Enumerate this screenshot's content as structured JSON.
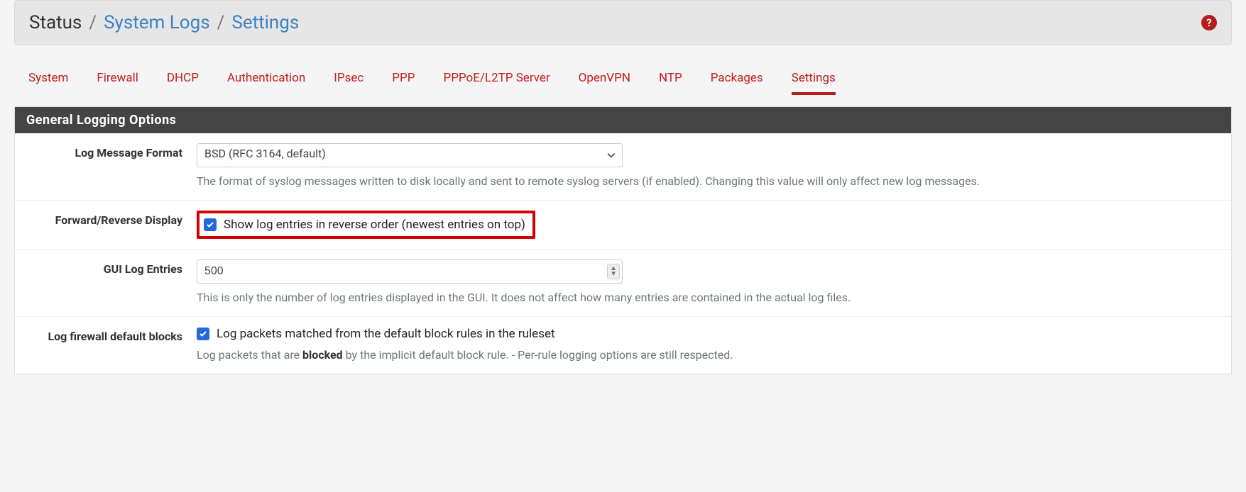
{
  "breadcrumb": {
    "root": "Status",
    "sep": "/",
    "mid": "System Logs",
    "leaf": "Settings"
  },
  "help_icon_glyph": "?",
  "tabs": {
    "system": "System",
    "firewall": "Firewall",
    "dhcp": "DHCP",
    "authentication": "Authentication",
    "ipsec": "IPsec",
    "ppp": "PPP",
    "pppoe": "PPPoE/L2TP Server",
    "openvpn": "OpenVPN",
    "ntp": "NTP",
    "packages": "Packages",
    "settings": "Settings"
  },
  "panel_title": "General Logging Options",
  "rows": {
    "log_format": {
      "label": "Log Message Format",
      "value": "BSD (RFC 3164, default)",
      "help": "The format of syslog messages written to disk locally and sent to remote syslog servers (if enabled). Changing this value will only affect new log messages."
    },
    "reverse": {
      "label": "Forward/Reverse Display",
      "checkbox_label": "Show log entries in reverse order (newest entries on top)"
    },
    "gui_entries": {
      "label": "GUI Log Entries",
      "value": "500",
      "help": "This is only the number of log entries displayed in the GUI. It does not affect how many entries are contained in the actual log files."
    },
    "fw_default": {
      "label": "Log firewall default blocks",
      "checkbox_label": "Log packets matched from the default block rules in the ruleset",
      "help_prefix": "Log packets that are ",
      "help_bold": "blocked",
      "help_suffix": " by the implicit default block rule. - Per-rule logging options are still respected."
    }
  }
}
